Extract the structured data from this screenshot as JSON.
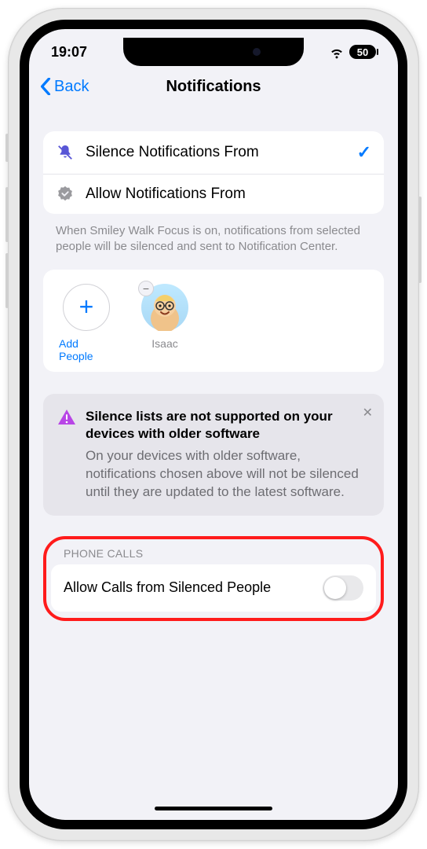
{
  "status": {
    "time": "19:07",
    "battery": "50"
  },
  "nav": {
    "back": "Back",
    "title": "Notifications"
  },
  "options": {
    "silence": "Silence Notifications From",
    "allow": "Allow Notifications From"
  },
  "helpText": "When Smiley Walk Focus is on, notifications from selected people will be silenced and sent to Notification Center.",
  "people": {
    "add": "Add People",
    "items": [
      {
        "name": "Isaac"
      }
    ]
  },
  "infoBox": {
    "title": "Silence lists are not supported on your devices with older software",
    "body": "On your devices with older software, notifications chosen above will not be silenced until they are updated to the latest software."
  },
  "phoneCalls": {
    "header": "PHONE CALLS",
    "allowLabel": "Allow Calls from Silenced People",
    "enabled": false
  }
}
